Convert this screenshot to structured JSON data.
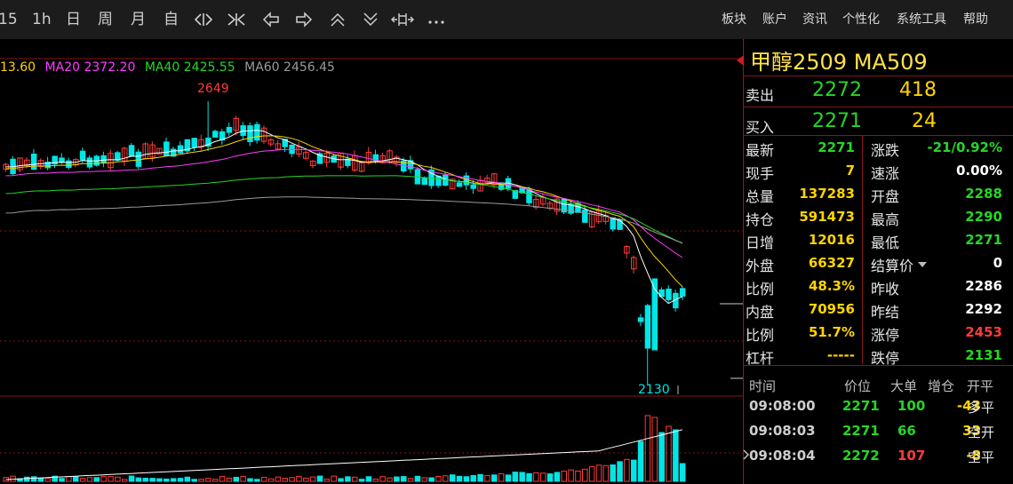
{
  "toolbar": {
    "periods": [
      "15",
      "1h",
      "日",
      "周",
      "月",
      "自"
    ],
    "menu": [
      "板块",
      "账户",
      "资讯",
      "个性化",
      "系统工具",
      "帮助"
    ]
  },
  "colors": {
    "up": "#ff3b3b",
    "down": "#00e5e5",
    "ma5": "#ffffff",
    "ma10": "#ffd400",
    "ma20": "#ff3cff",
    "ma40": "#26d626",
    "ma60": "#9a9a9a",
    "grid": "#8a1212"
  },
  "ma_legend": [
    {
      "text": "13.60",
      "color": "#ffd400"
    },
    {
      "text": "MA20 2372.20",
      "color": "#ff3cff"
    },
    {
      "text": "MA40 2425.55",
      "color": "#26d626"
    },
    {
      "text": "MA60 2456.45",
      "color": "#9a9a9a"
    }
  ],
  "chart_data": {
    "type": "candlestick",
    "high_label": "2649",
    "low_label": "2130",
    "y_range": [
      2120,
      2660
    ]
  },
  "quote": {
    "title": "甲醇2509  MA509",
    "sell": {
      "label": "卖出",
      "price": "2272",
      "volume": "418"
    },
    "buy": {
      "label": "买入",
      "price": "2271",
      "volume": "24"
    },
    "left": [
      {
        "label": "最新",
        "value": "2271",
        "color": "#26d626"
      },
      {
        "label": "现手",
        "value": "7",
        "color": "#ffd400"
      },
      {
        "label": "总量",
        "value": "137283",
        "color": "#ffd400"
      },
      {
        "label": "持仓",
        "value": "591473",
        "color": "#ffd400"
      },
      {
        "label": "日增",
        "value": "12016",
        "color": "#ffd400"
      },
      {
        "label": "外盘",
        "value": "66327",
        "color": "#ffd400"
      },
      {
        "label": "比例",
        "value": "48.3%",
        "color": "#ffd400"
      },
      {
        "label": "内盘",
        "value": "70956",
        "color": "#ffd400"
      },
      {
        "label": "比例",
        "value": "51.7%",
        "color": "#ffd400"
      },
      {
        "label": "杠杆",
        "value": "-----",
        "color": "#ffd400"
      }
    ],
    "right": [
      {
        "label": "涨跌",
        "value": "-21/0.92%",
        "color": "#26d626"
      },
      {
        "label": "速涨",
        "value": "0.00%",
        "color": "#ffffff"
      },
      {
        "label": "开盘",
        "value": "2288",
        "color": "#26d626"
      },
      {
        "label": "最高",
        "value": "2290",
        "color": "#26d626"
      },
      {
        "label": "最低",
        "value": "2271",
        "color": "#26d626"
      },
      {
        "label": "结算价",
        "value": "0",
        "color": "#ffffff"
      },
      {
        "label": "昨收",
        "value": "2286",
        "color": "#ffffff"
      },
      {
        "label": "昨结",
        "value": "2292",
        "color": "#ffffff"
      },
      {
        "label": "涨停",
        "value": "2453",
        "color": "#ff3b3b"
      },
      {
        "label": "跌停",
        "value": "2131",
        "color": "#26d626"
      }
    ],
    "trades_header": [
      "时间",
      "价位",
      "大单",
      "增仓",
      "开平"
    ],
    "trades": [
      {
        "time": "09:08:00",
        "price": "2271",
        "big": "100",
        "change": "-43",
        "type": "多平",
        "big_color": "#26d626"
      },
      {
        "time": "09:08:03",
        "price": "2271",
        "big": "66",
        "change": "33",
        "type": "空开",
        "big_color": "#26d626"
      },
      {
        "time": "09:08:04",
        "price": "2272",
        "big": "107",
        "change": "-8",
        "type": "空平",
        "big_color": "#ff3b3b"
      }
    ]
  }
}
